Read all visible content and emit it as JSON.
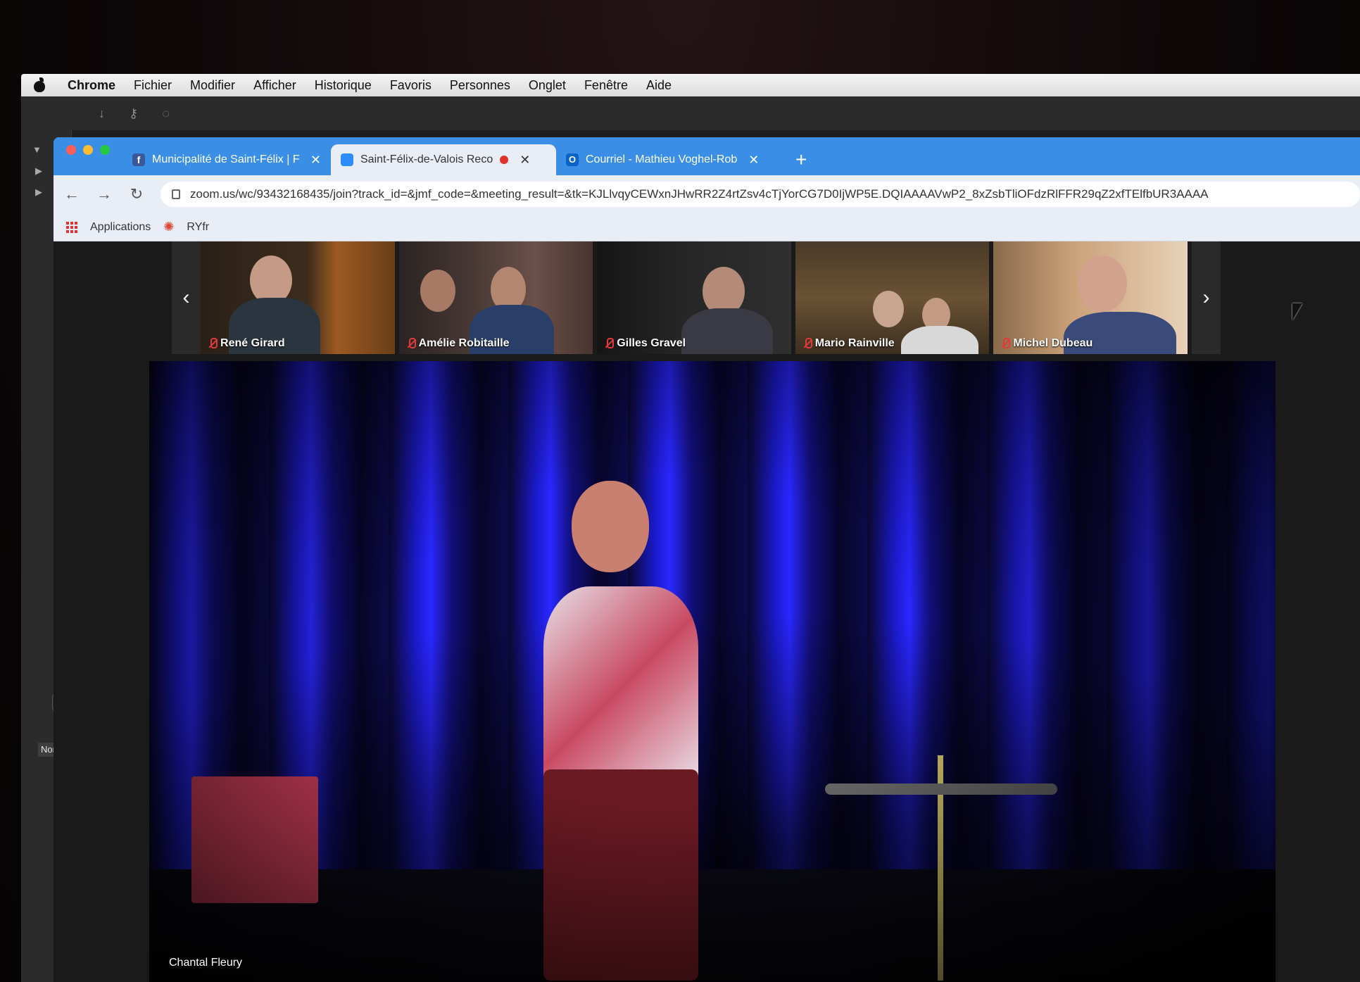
{
  "menubar": {
    "items": [
      "Chrome",
      "Fichier",
      "Modifier",
      "Afficher",
      "Historique",
      "Favoris",
      "Personnes",
      "Onglet",
      "Fenêtre",
      "Aide"
    ]
  },
  "finder": {
    "column_header": "Nom",
    "placeholder_fragment": "Pl"
  },
  "tabs": [
    {
      "label": "Municipalité de Saint-Félix | Fa",
      "icon": "facebook-icon",
      "active": false,
      "color": "#3b5998"
    },
    {
      "label": "Saint-Félix-de-Valois Reco",
      "icon": "zoom-icon",
      "active": true,
      "recording": true,
      "color": "#2d8cff"
    },
    {
      "label": "Courriel - Mathieu Voghel-Rob",
      "icon": "outlook-icon",
      "active": false,
      "color": "#0a64c8"
    }
  ],
  "toolbar": {
    "url": "zoom.us/wc/93432168435/join?track_id=&jmf_code=&meeting_result=&tk=KJLlvqyCEWxnJHwRR2Z4rtZsv4cTjYorCG7D0IjWP5E.DQIAAAAVwP2_8xZsbTliOFdzRlFFR29qZ2xfTElfbUR3AAAA"
  },
  "bookmarks": {
    "items": [
      {
        "label": "Applications",
        "icon": "apps-grid-icon"
      },
      {
        "label": "RYfr",
        "icon": "radio-canada-icon"
      }
    ]
  },
  "zoom": {
    "participants": [
      {
        "name": "René Girard",
        "muted": true
      },
      {
        "name": "Amélie Robitaille",
        "muted": true
      },
      {
        "name": "Gilles Gravel",
        "muted": true
      },
      {
        "name": "Mario Rainville",
        "muted": true
      },
      {
        "name": "Michel Dubeau",
        "muted": true
      }
    ],
    "speaker": {
      "name": "Chantal Fleury"
    }
  },
  "colors": {
    "tabstrip": "#3a8ee6",
    "recording": "#e0322d",
    "muted": "#e23a3a",
    "stage_light": "#2a28ff"
  }
}
